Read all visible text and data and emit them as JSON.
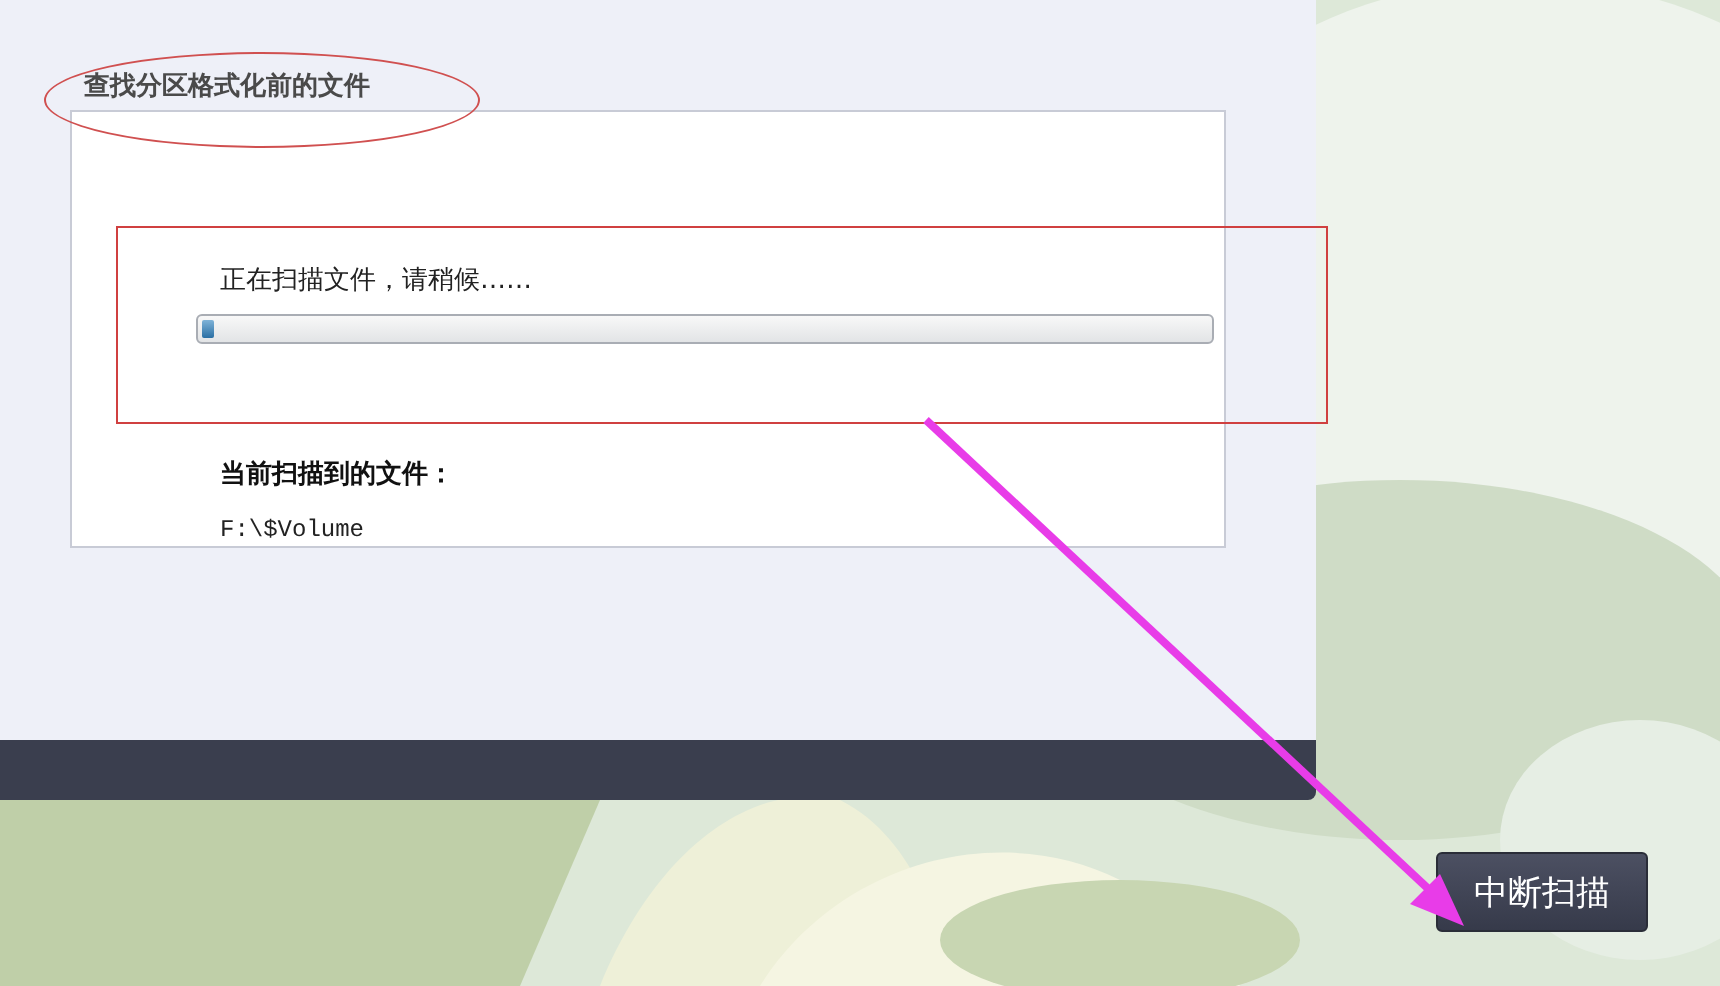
{
  "dialog": {
    "title": "查找分区格式化前的文件",
    "status": "正在扫描文件，请稍候……",
    "progress": {
      "level": 0.012
    },
    "current_label": "当前扫描到的文件：",
    "current_file": "F:\\$Volume"
  },
  "stop_button": {
    "label": "中断扫描"
  },
  "annotations": [
    {
      "kind": "ellipse"
    },
    {
      "kind": "rectangle"
    },
    {
      "kind": "arrow"
    }
  ]
}
